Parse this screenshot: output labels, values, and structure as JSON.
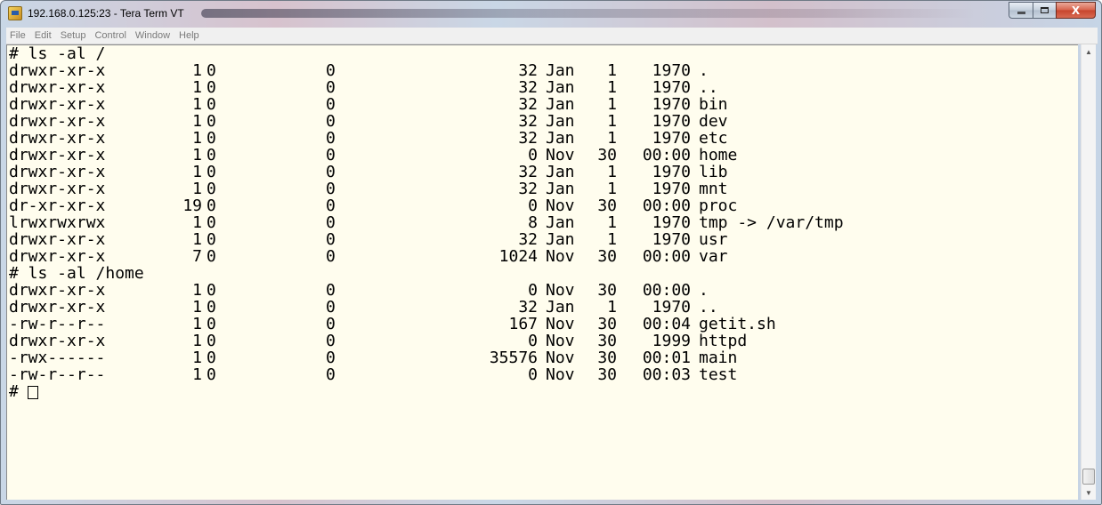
{
  "window": {
    "title": "192.168.0.125:23 - Tera Term VT",
    "icons": {
      "app": "teraterm-app-icon",
      "minimize": "minimize-icon",
      "maximize": "maximize-icon",
      "close": "close-icon"
    },
    "close_glyph": "X"
  },
  "menu": [
    "File",
    "Edit",
    "Setup",
    "Control",
    "Window",
    "Help"
  ],
  "colors": {
    "terminal_bg": "#fffdee",
    "text": "#000000",
    "menu_text": "#7a7a7a",
    "close_button": "#c7442c"
  },
  "terminal": {
    "lines": [
      {
        "type": "cmd",
        "text": "# ls -al /"
      },
      {
        "type": "entry",
        "perm": "drwxr-xr-x",
        "links": "1",
        "owner": "0",
        "group": "0",
        "size": "32",
        "month": "Jan",
        "day": "1",
        "time": "1970",
        "name": "."
      },
      {
        "type": "entry",
        "perm": "drwxr-xr-x",
        "links": "1",
        "owner": "0",
        "group": "0",
        "size": "32",
        "month": "Jan",
        "day": "1",
        "time": "1970",
        "name": ".."
      },
      {
        "type": "entry",
        "perm": "drwxr-xr-x",
        "links": "1",
        "owner": "0",
        "group": "0",
        "size": "32",
        "month": "Jan",
        "day": "1",
        "time": "1970",
        "name": "bin"
      },
      {
        "type": "entry",
        "perm": "drwxr-xr-x",
        "links": "1",
        "owner": "0",
        "group": "0",
        "size": "32",
        "month": "Jan",
        "day": "1",
        "time": "1970",
        "name": "dev"
      },
      {
        "type": "entry",
        "perm": "drwxr-xr-x",
        "links": "1",
        "owner": "0",
        "group": "0",
        "size": "32",
        "month": "Jan",
        "day": "1",
        "time": "1970",
        "name": "etc"
      },
      {
        "type": "entry",
        "perm": "drwxr-xr-x",
        "links": "1",
        "owner": "0",
        "group": "0",
        "size": "0",
        "month": "Nov",
        "day": "30",
        "time": "00:00",
        "name": "home"
      },
      {
        "type": "entry",
        "perm": "drwxr-xr-x",
        "links": "1",
        "owner": "0",
        "group": "0",
        "size": "32",
        "month": "Jan",
        "day": "1",
        "time": "1970",
        "name": "lib"
      },
      {
        "type": "entry",
        "perm": "drwxr-xr-x",
        "links": "1",
        "owner": "0",
        "group": "0",
        "size": "32",
        "month": "Jan",
        "day": "1",
        "time": "1970",
        "name": "mnt"
      },
      {
        "type": "entry",
        "perm": "dr-xr-xr-x",
        "links": "19",
        "owner": "0",
        "group": "0",
        "size": "0",
        "month": "Nov",
        "day": "30",
        "time": "00:00",
        "name": "proc"
      },
      {
        "type": "entry",
        "perm": "lrwxrwxrwx",
        "links": "1",
        "owner": "0",
        "group": "0",
        "size": "8",
        "month": "Jan",
        "day": "1",
        "time": "1970",
        "name": "tmp -> /var/tmp"
      },
      {
        "type": "entry",
        "perm": "drwxr-xr-x",
        "links": "1",
        "owner": "0",
        "group": "0",
        "size": "32",
        "month": "Jan",
        "day": "1",
        "time": "1970",
        "name": "usr"
      },
      {
        "type": "entry",
        "perm": "drwxr-xr-x",
        "links": "7",
        "owner": "0",
        "group": "0",
        "size": "1024",
        "month": "Nov",
        "day": "30",
        "time": "00:00",
        "name": "var"
      },
      {
        "type": "cmd",
        "text": "# ls -al /home"
      },
      {
        "type": "entry",
        "perm": "drwxr-xr-x",
        "links": "1",
        "owner": "0",
        "group": "0",
        "size": "0",
        "month": "Nov",
        "day": "30",
        "time": "00:00",
        "name": "."
      },
      {
        "type": "entry",
        "perm": "drwxr-xr-x",
        "links": "1",
        "owner": "0",
        "group": "0",
        "size": "32",
        "month": "Jan",
        "day": "1",
        "time": "1970",
        "name": ".."
      },
      {
        "type": "entry",
        "perm": "-rw-r--r--",
        "links": "1",
        "owner": "0",
        "group": "0",
        "size": "167",
        "month": "Nov",
        "day": "30",
        "time": "00:04",
        "name": "getit.sh"
      },
      {
        "type": "entry",
        "perm": "drwxr-xr-x",
        "links": "1",
        "owner": "0",
        "group": "0",
        "size": "0",
        "month": "Nov",
        "day": "30",
        "time": "1999",
        "name": "httpd"
      },
      {
        "type": "entry",
        "perm": "-rwx------",
        "links": "1",
        "owner": "0",
        "group": "0",
        "size": "35576",
        "month": "Nov",
        "day": "30",
        "time": "00:01",
        "name": "main"
      },
      {
        "type": "entry",
        "perm": "-rw-r--r--",
        "links": "1",
        "owner": "0",
        "group": "0",
        "size": "0",
        "month": "Nov",
        "day": "30",
        "time": "00:03",
        "name": "test"
      }
    ],
    "prompt": "#"
  },
  "scrollbar": {
    "up_arrow": "▲",
    "down_arrow": "▼"
  }
}
